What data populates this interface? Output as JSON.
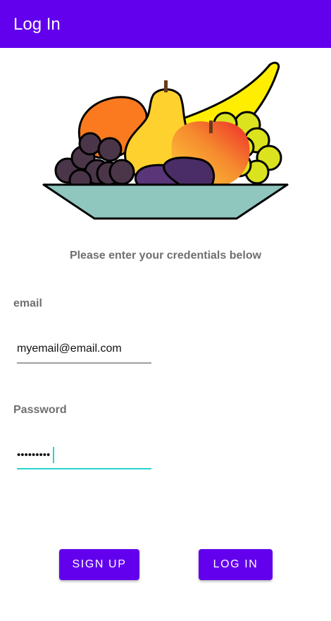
{
  "app_bar": {
    "title": "Log In",
    "color": "#6200ee"
  },
  "hero": {
    "icon": "fruit-bowl-illustration"
  },
  "form": {
    "prompt": "Please enter your credentials below",
    "email": {
      "label": "email",
      "value": "myemail@email.com"
    },
    "password": {
      "label": "Password",
      "value": "•••••••••",
      "focused": true,
      "accent": "#26d6cf"
    }
  },
  "buttons": {
    "signup_label": "SIGN UP",
    "login_label": "LOG IN"
  }
}
